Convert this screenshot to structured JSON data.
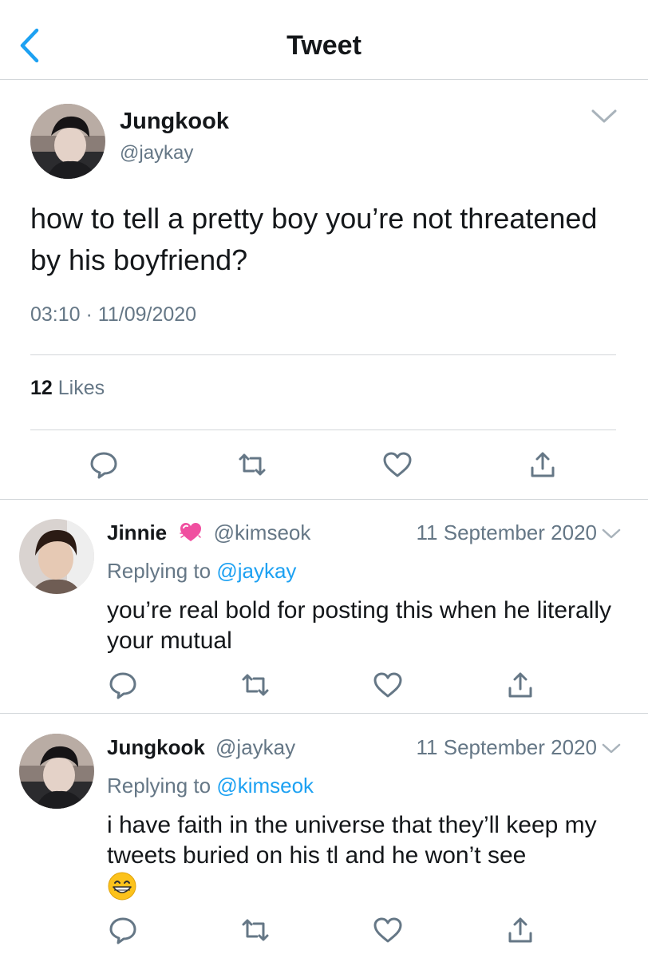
{
  "header": {
    "title": "Tweet",
    "back_icon": "chevron-left-icon"
  },
  "colors": {
    "accent": "#1da1f2",
    "secondary_text": "#657786",
    "divider": "#d2d6d9",
    "text": "#14171a"
  },
  "main_tweet": {
    "name": "Jungkook",
    "handle": "@jaykay",
    "text": "how to tell a pretty boy you’re not threatened by his boyfriend?",
    "time": "03:10",
    "separator": "·",
    "date": "11/09/2020",
    "likes_count": "12",
    "likes_label": "Likes",
    "actions": [
      "reply-icon",
      "retweet-icon",
      "like-icon",
      "share-icon"
    ]
  },
  "replies": [
    {
      "name": "Jinnie",
      "emoji": "heart-emoji",
      "handle": "@kimseok",
      "date": "11 September 2020",
      "replying_label": "Replying to",
      "replying_to": "@jaykay",
      "text": "you’re real bold for posting this when he literally your mutual"
    },
    {
      "name": "Jungkook",
      "handle": "@jaykay",
      "date": "11 September 2020",
      "replying_label": "Replying to",
      "replying_to": "@kimseok",
      "text": "i have faith in the universe that they’ll keep my tweets buried on his tl and he won’t see",
      "trailing_emoji": "grinning-face-emoji"
    }
  ]
}
